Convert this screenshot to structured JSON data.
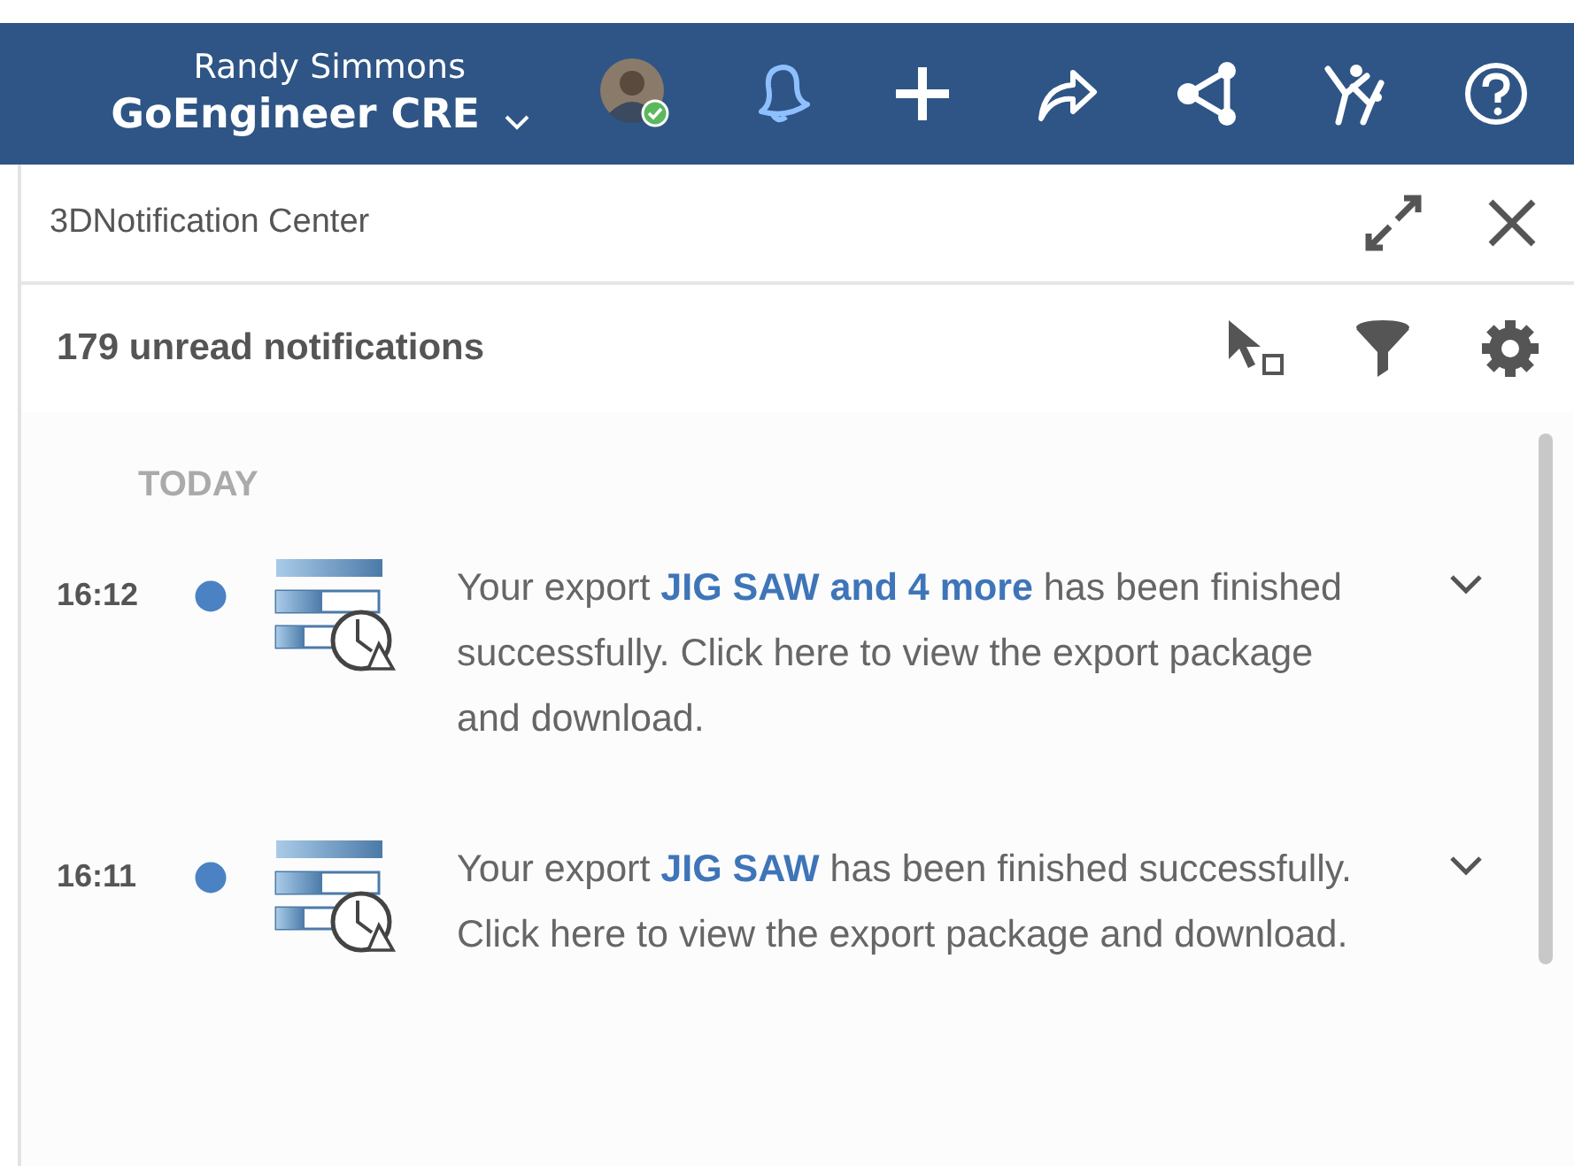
{
  "topbar": {
    "user_name": "Randy Simmons",
    "tenant": "GoEngineer CRE",
    "user_online": true
  },
  "panel": {
    "title": "3DNotification Center",
    "unread_count": "179 unread notifications",
    "section": "TODAY"
  },
  "notifications": [
    {
      "time": "16:12",
      "unread": true,
      "prefix": "Your export ",
      "link": "JIG SAW and 4 more",
      "suffix": " has been finished successfully. Click here to view the export package and download."
    },
    {
      "time": "16:11",
      "unread": true,
      "prefix": "Your export ",
      "link": "JIG SAW",
      "suffix": " has been finished successfully. Click here to view the export package and download."
    }
  ]
}
